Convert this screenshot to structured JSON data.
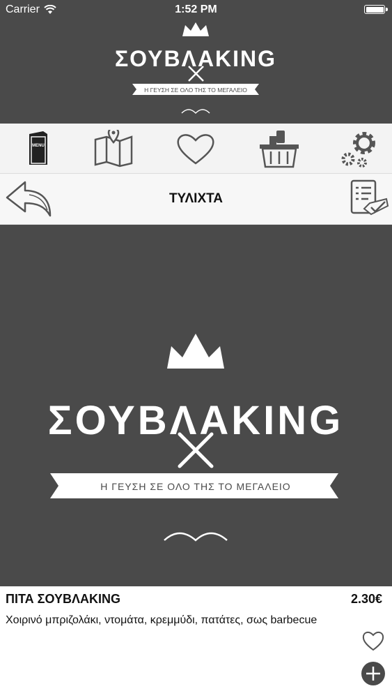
{
  "status_bar": {
    "carrier": "Carrier",
    "time": "1:52 PM"
  },
  "brand": {
    "name": "ΣΟΥΒΛΑΚING",
    "tagline": "Η ΓΕΥΣΗ ΣΕ ΟΛΟ ΤΗΣ ΤΟ ΜΕΓΑΛΕΙΟ"
  },
  "tabs": [
    {
      "icon": "menu-icon",
      "label": "MENU"
    },
    {
      "icon": "map-icon"
    },
    {
      "icon": "heart-icon"
    },
    {
      "icon": "basket-icon"
    },
    {
      "icon": "settings-icon"
    }
  ],
  "nav": {
    "title": "ΤΥΛΙΧΤΑ",
    "left_icon": "back-arrow-icon",
    "right_icon": "order-checklist-icon"
  },
  "product": {
    "name": "ΠΙΤΑ ΣΟΥΒΛΑΚING",
    "price": "2.30€",
    "description": "Χοιρινό μπριζολάκι, ντομάτα, κρεμμύδι, πατάτες, σως barbecue",
    "favorite_icon": "heart-outline-icon",
    "add_icon": "plus-circle-icon"
  },
  "colors": {
    "dark": "#4a4a4a",
    "bar": "#f3f3f3",
    "text": "#111111"
  }
}
